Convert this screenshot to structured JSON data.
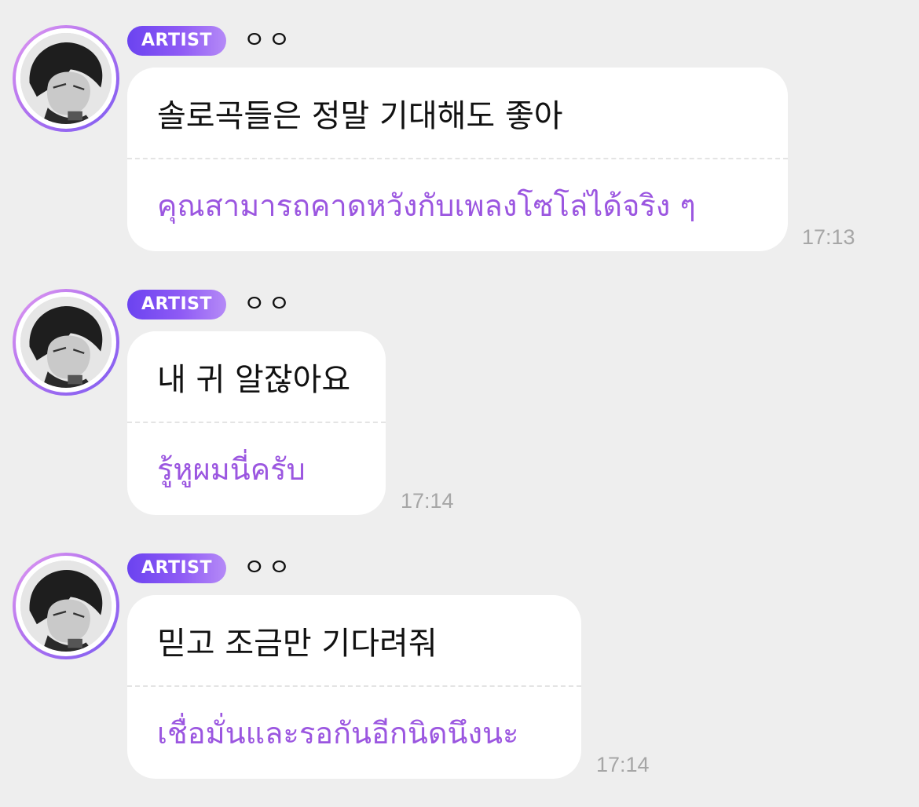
{
  "messages": [
    {
      "badge": "ARTIST",
      "nickname": "ㅇㅇ",
      "original": "솔로곡들은 정말 기대해도 좋아",
      "translation": "คุณสามารถคาดหวังกับเพลงโซโล่ได้จริง ๆ",
      "time": "17:13"
    },
    {
      "badge": "ARTIST",
      "nickname": "ㅇㅇ",
      "original": "내 귀 알잖아요",
      "translation": "รู้หูผมนี่ครับ",
      "time": "17:14"
    },
    {
      "badge": "ARTIST",
      "nickname": "ㅇㅇ",
      "original": "믿고 조금만 기다려줘",
      "translation": "เชื่อมั่นและรอกันอีกนิดนึงนะ",
      "time": "17:14"
    }
  ],
  "colors": {
    "background": "#eeeeee",
    "bubble": "#ffffff",
    "badge_gradient_start": "#6b43f0",
    "badge_gradient_end": "#b58af7",
    "translation_text": "#9b56e0",
    "timestamp": "#a6a6a6"
  },
  "icons": {
    "avatar": "artist-profile-photo"
  }
}
